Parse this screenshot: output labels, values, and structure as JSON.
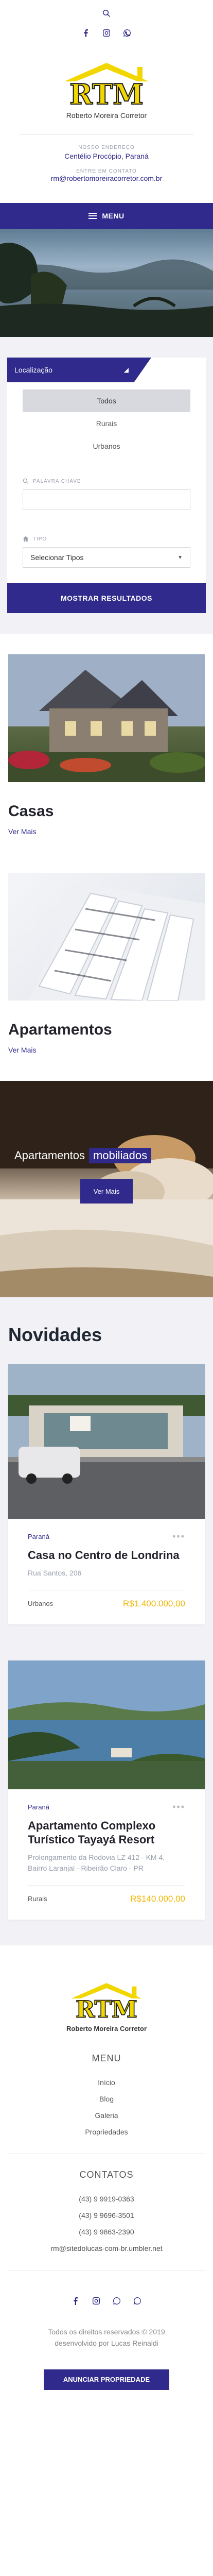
{
  "brand": {
    "name": "Roberto Moreira Corretor",
    "logo_text": "RTM"
  },
  "header": {
    "address_label": "NOSSO ENDEREÇO",
    "address_value": "Centélio Procópio, Paraná",
    "contact_label": "ENTRE EM CONTATO",
    "contact_value": "rm@robertomoreiracorretor.com.br"
  },
  "nav": {
    "menu_label": "MENU"
  },
  "search": {
    "location_tab": "Localização",
    "locations": [
      "Todos",
      "Rurais",
      "Urbanos"
    ],
    "keyword_label": "PALAVRA CHAVE",
    "keyword_placeholder": "",
    "type_label": "TIPO",
    "type_selected": "Selecionar Tipos",
    "submit": "MOSTRAR RESULTADOS"
  },
  "categories": [
    {
      "title": "Casas",
      "link": "Ver Mais"
    },
    {
      "title": "Apartamentos",
      "link": "Ver Mais"
    }
  ],
  "furnished": {
    "prefix": "Apartamentos",
    "highlight": "mobiliados",
    "button": "Ver Mais"
  },
  "news": {
    "title": "Novidades",
    "properties": [
      {
        "state": "Paraná",
        "name": "Casa no Centro de Londrina",
        "address": "Rua Santos, 206",
        "type": "Urbanos",
        "price": "R$1.400.000,00"
      },
      {
        "state": "Paraná",
        "name": "Apartamento Complexo Turístico Tayayá Resort",
        "address": "Prolongamento da Rodovia LZ 412 - KM 4, Bairro Laranjal - Ribeirão Claro - PR",
        "type": "Rurais",
        "price": "R$140.000,00"
      }
    ]
  },
  "footer": {
    "menu_heading": "MENU",
    "links": [
      "Início",
      "Blog",
      "Galeria",
      "Propriedades"
    ],
    "contacts_heading": "CONTATOS",
    "phones": [
      "(43) 9 9919-0363",
      "(43) 9 9696-3501",
      "(43) 9 9863-2390"
    ],
    "email": "rm@sitedolucas-com-br.umbler.net",
    "copyright": "Todos os direitos reservados © 2019",
    "credit": "desenvolvido por Lucas Reinaldi",
    "cta": "ANUNCIAR PROPRIEDADE"
  },
  "icons": [
    "search-icon",
    "facebook-icon",
    "instagram-icon",
    "whatsapp-icon"
  ],
  "colors": {
    "primary": "#2f2a8c",
    "accent": "#f2b705",
    "background_alt": "#f1f1f6"
  }
}
